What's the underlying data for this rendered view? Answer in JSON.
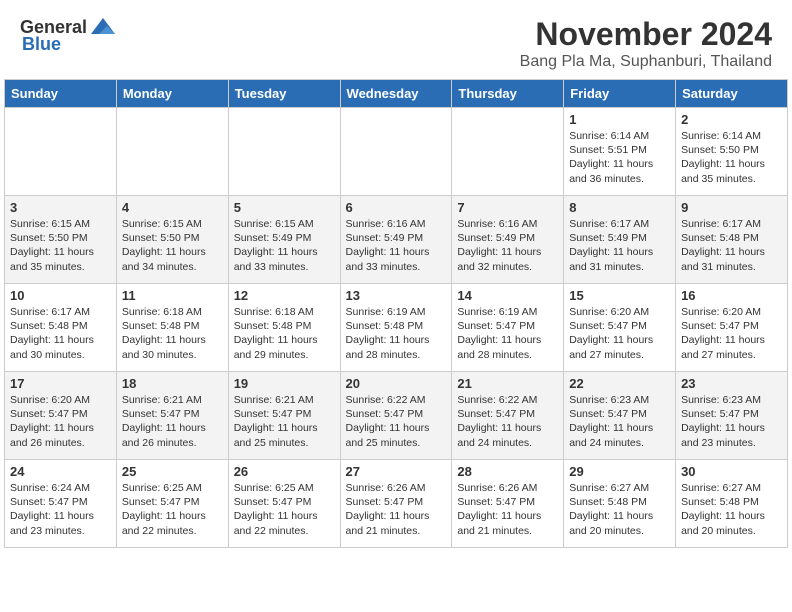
{
  "header": {
    "logo_general": "General",
    "logo_blue": "Blue",
    "month_title": "November 2024",
    "location": "Bang Pla Ma, Suphanburi, Thailand"
  },
  "weekdays": [
    "Sunday",
    "Monday",
    "Tuesday",
    "Wednesday",
    "Thursday",
    "Friday",
    "Saturday"
  ],
  "weeks": [
    {
      "stripe": false,
      "days": [
        {
          "num": "",
          "info": ""
        },
        {
          "num": "",
          "info": ""
        },
        {
          "num": "",
          "info": ""
        },
        {
          "num": "",
          "info": ""
        },
        {
          "num": "",
          "info": ""
        },
        {
          "num": "1",
          "info": "Sunrise: 6:14 AM\nSunset: 5:51 PM\nDaylight: 11 hours\nand 36 minutes."
        },
        {
          "num": "2",
          "info": "Sunrise: 6:14 AM\nSunset: 5:50 PM\nDaylight: 11 hours\nand 35 minutes."
        }
      ]
    },
    {
      "stripe": true,
      "days": [
        {
          "num": "3",
          "info": "Sunrise: 6:15 AM\nSunset: 5:50 PM\nDaylight: 11 hours\nand 35 minutes."
        },
        {
          "num": "4",
          "info": "Sunrise: 6:15 AM\nSunset: 5:50 PM\nDaylight: 11 hours\nand 34 minutes."
        },
        {
          "num": "5",
          "info": "Sunrise: 6:15 AM\nSunset: 5:49 PM\nDaylight: 11 hours\nand 33 minutes."
        },
        {
          "num": "6",
          "info": "Sunrise: 6:16 AM\nSunset: 5:49 PM\nDaylight: 11 hours\nand 33 minutes."
        },
        {
          "num": "7",
          "info": "Sunrise: 6:16 AM\nSunset: 5:49 PM\nDaylight: 11 hours\nand 32 minutes."
        },
        {
          "num": "8",
          "info": "Sunrise: 6:17 AM\nSunset: 5:49 PM\nDaylight: 11 hours\nand 31 minutes."
        },
        {
          "num": "9",
          "info": "Sunrise: 6:17 AM\nSunset: 5:48 PM\nDaylight: 11 hours\nand 31 minutes."
        }
      ]
    },
    {
      "stripe": false,
      "days": [
        {
          "num": "10",
          "info": "Sunrise: 6:17 AM\nSunset: 5:48 PM\nDaylight: 11 hours\nand 30 minutes."
        },
        {
          "num": "11",
          "info": "Sunrise: 6:18 AM\nSunset: 5:48 PM\nDaylight: 11 hours\nand 30 minutes."
        },
        {
          "num": "12",
          "info": "Sunrise: 6:18 AM\nSunset: 5:48 PM\nDaylight: 11 hours\nand 29 minutes."
        },
        {
          "num": "13",
          "info": "Sunrise: 6:19 AM\nSunset: 5:48 PM\nDaylight: 11 hours\nand 28 minutes."
        },
        {
          "num": "14",
          "info": "Sunrise: 6:19 AM\nSunset: 5:47 PM\nDaylight: 11 hours\nand 28 minutes."
        },
        {
          "num": "15",
          "info": "Sunrise: 6:20 AM\nSunset: 5:47 PM\nDaylight: 11 hours\nand 27 minutes."
        },
        {
          "num": "16",
          "info": "Sunrise: 6:20 AM\nSunset: 5:47 PM\nDaylight: 11 hours\nand 27 minutes."
        }
      ]
    },
    {
      "stripe": true,
      "days": [
        {
          "num": "17",
          "info": "Sunrise: 6:20 AM\nSunset: 5:47 PM\nDaylight: 11 hours\nand 26 minutes."
        },
        {
          "num": "18",
          "info": "Sunrise: 6:21 AM\nSunset: 5:47 PM\nDaylight: 11 hours\nand 26 minutes."
        },
        {
          "num": "19",
          "info": "Sunrise: 6:21 AM\nSunset: 5:47 PM\nDaylight: 11 hours\nand 25 minutes."
        },
        {
          "num": "20",
          "info": "Sunrise: 6:22 AM\nSunset: 5:47 PM\nDaylight: 11 hours\nand 25 minutes."
        },
        {
          "num": "21",
          "info": "Sunrise: 6:22 AM\nSunset: 5:47 PM\nDaylight: 11 hours\nand 24 minutes."
        },
        {
          "num": "22",
          "info": "Sunrise: 6:23 AM\nSunset: 5:47 PM\nDaylight: 11 hours\nand 24 minutes."
        },
        {
          "num": "23",
          "info": "Sunrise: 6:23 AM\nSunset: 5:47 PM\nDaylight: 11 hours\nand 23 minutes."
        }
      ]
    },
    {
      "stripe": false,
      "days": [
        {
          "num": "24",
          "info": "Sunrise: 6:24 AM\nSunset: 5:47 PM\nDaylight: 11 hours\nand 23 minutes."
        },
        {
          "num": "25",
          "info": "Sunrise: 6:25 AM\nSunset: 5:47 PM\nDaylight: 11 hours\nand 22 minutes."
        },
        {
          "num": "26",
          "info": "Sunrise: 6:25 AM\nSunset: 5:47 PM\nDaylight: 11 hours\nand 22 minutes."
        },
        {
          "num": "27",
          "info": "Sunrise: 6:26 AM\nSunset: 5:47 PM\nDaylight: 11 hours\nand 21 minutes."
        },
        {
          "num": "28",
          "info": "Sunrise: 6:26 AM\nSunset: 5:47 PM\nDaylight: 11 hours\nand 21 minutes."
        },
        {
          "num": "29",
          "info": "Sunrise: 6:27 AM\nSunset: 5:48 PM\nDaylight: 11 hours\nand 20 minutes."
        },
        {
          "num": "30",
          "info": "Sunrise: 6:27 AM\nSunset: 5:48 PM\nDaylight: 11 hours\nand 20 minutes."
        }
      ]
    }
  ]
}
